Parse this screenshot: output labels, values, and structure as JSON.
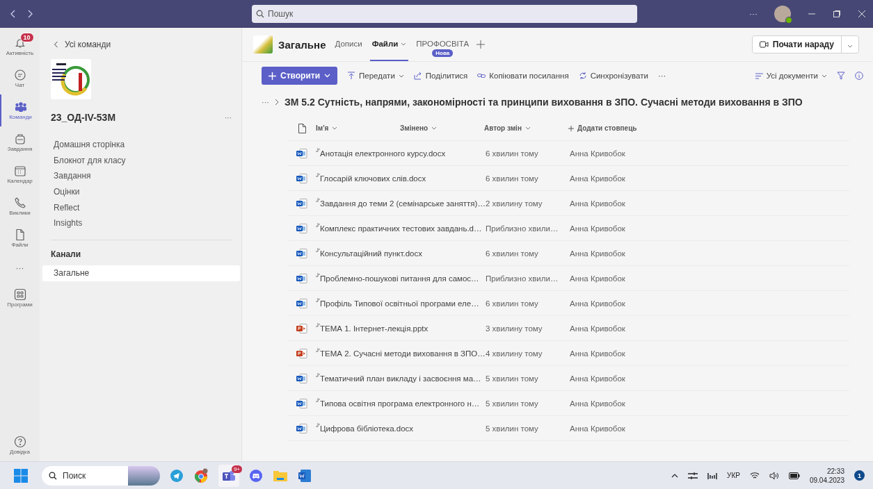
{
  "title_bar": {
    "search": {
      "placeholder": "Пошук"
    },
    "more": "···"
  },
  "app_bar": {
    "items": [
      {
        "label": "Активність",
        "selected": false,
        "badge": "10"
      },
      {
        "label": "Чат",
        "selected": false
      },
      {
        "label": "Команди",
        "selected": true
      },
      {
        "label": "Завдання",
        "selected": false
      },
      {
        "label": "Календар",
        "selected": false
      },
      {
        "label": "Виклики",
        "selected": false
      },
      {
        "label": "Файли",
        "selected": false
      }
    ],
    "more": "···",
    "apps": "Програми",
    "help": "Довідка"
  },
  "team_panel": {
    "back": "Усі команди",
    "team_name": "23_ОД-IV-53М",
    "menu": "···",
    "nav": [
      "Домашня сторінка",
      "Блокнот для класу",
      "Завдання",
      "Оцінки",
      "Reflect",
      "Insights"
    ],
    "channels_heading": "Канали",
    "channels": [
      {
        "label": "Загальне",
        "selected": true
      }
    ]
  },
  "channel_header": {
    "name": "Загальне",
    "tabs": [
      {
        "label": "Дописи",
        "selected": false,
        "dropdown": false
      },
      {
        "label": "Файли",
        "selected": true,
        "dropdown": true
      },
      {
        "label": "ПРОФОСВІТА",
        "selected": false,
        "dropdown": false,
        "badge": "Нова"
      }
    ],
    "meet_button": "Почати нараду"
  },
  "toolbar": {
    "create": "Створити",
    "actions": [
      {
        "label": "Передати",
        "dropdown": true
      },
      {
        "label": "Поділитися",
        "dropdown": false
      },
      {
        "label": "Копіювати посилання",
        "dropdown": false
      },
      {
        "label": "Синхронізувати",
        "dropdown": false
      }
    ],
    "more": "···",
    "view": "Усі документи"
  },
  "breadcrumb": {
    "more": "···",
    "current": "ЗМ 5.2 Сутність, напрями, закономірності та принципи виховання в ЗПО. Сучасні методи виховання в ЗПО"
  },
  "table": {
    "columns": [
      "Ім'я",
      "Змінено",
      "Автор змін"
    ],
    "add_column": "Додати стовпець",
    "rows": [
      {
        "kind": "word",
        "name": "Анотація електронного курсу.docx",
        "modified": "6 хвилин тому",
        "author": "Анна Кривобок"
      },
      {
        "kind": "word",
        "name": "Глосарій ключових слів.docx",
        "modified": "6 хвилин тому",
        "author": "Анна Кривобок"
      },
      {
        "kind": "word",
        "name": "Завдання до теми 2 (семінарське заняття)…",
        "modified": "2 хвилину тому",
        "author": "Анна Кривобок"
      },
      {
        "kind": "word",
        "name": "Комплекс практичних тестових завдань.d…",
        "modified": "Приблизно хвили…",
        "author": "Анна Кривобок"
      },
      {
        "kind": "word",
        "name": "Консультаційний пункт.docx",
        "modified": "6 хвилин тому",
        "author": "Анна Кривобок"
      },
      {
        "kind": "word",
        "name": "Проблемно-пошукові питання для самос…",
        "modified": "Приблизно хвили…",
        "author": "Анна Кривобок"
      },
      {
        "kind": "word",
        "name": "Профіль Типової освітньої програми еле…",
        "modified": "6 хвилин тому",
        "author": "Анна Кривобок"
      },
      {
        "kind": "powerpoint",
        "name": "ТЕМА 1. Інтернет-лекція.pptx",
        "modified": "3 хвилину тому",
        "author": "Анна Кривобок"
      },
      {
        "kind": "powerpoint",
        "name": "ТЕМА 2. Сучасні методи виховання в ЗПО…",
        "modified": "4 хвилину тому",
        "author": "Анна Кривобок"
      },
      {
        "kind": "word",
        "name": "Тематичний план викладу і засвоєння ма…",
        "modified": "5 хвилин тому",
        "author": "Анна Кривобок"
      },
      {
        "kind": "word",
        "name": "Типова освітня програма електронного н…",
        "modified": "5 хвилин тому",
        "author": "Анна Кривобок"
      },
      {
        "kind": "word",
        "name": "Цифрова бібліотека.docx",
        "modified": "5 хвилин тому",
        "author": "Анна Кривобок"
      }
    ]
  },
  "taskbar": {
    "search": {
      "placeholder": "Поиск"
    },
    "teams_badge": "9+",
    "language": "УКР",
    "time": "22:33",
    "date": "09.04.2023",
    "notifications": "1"
  }
}
